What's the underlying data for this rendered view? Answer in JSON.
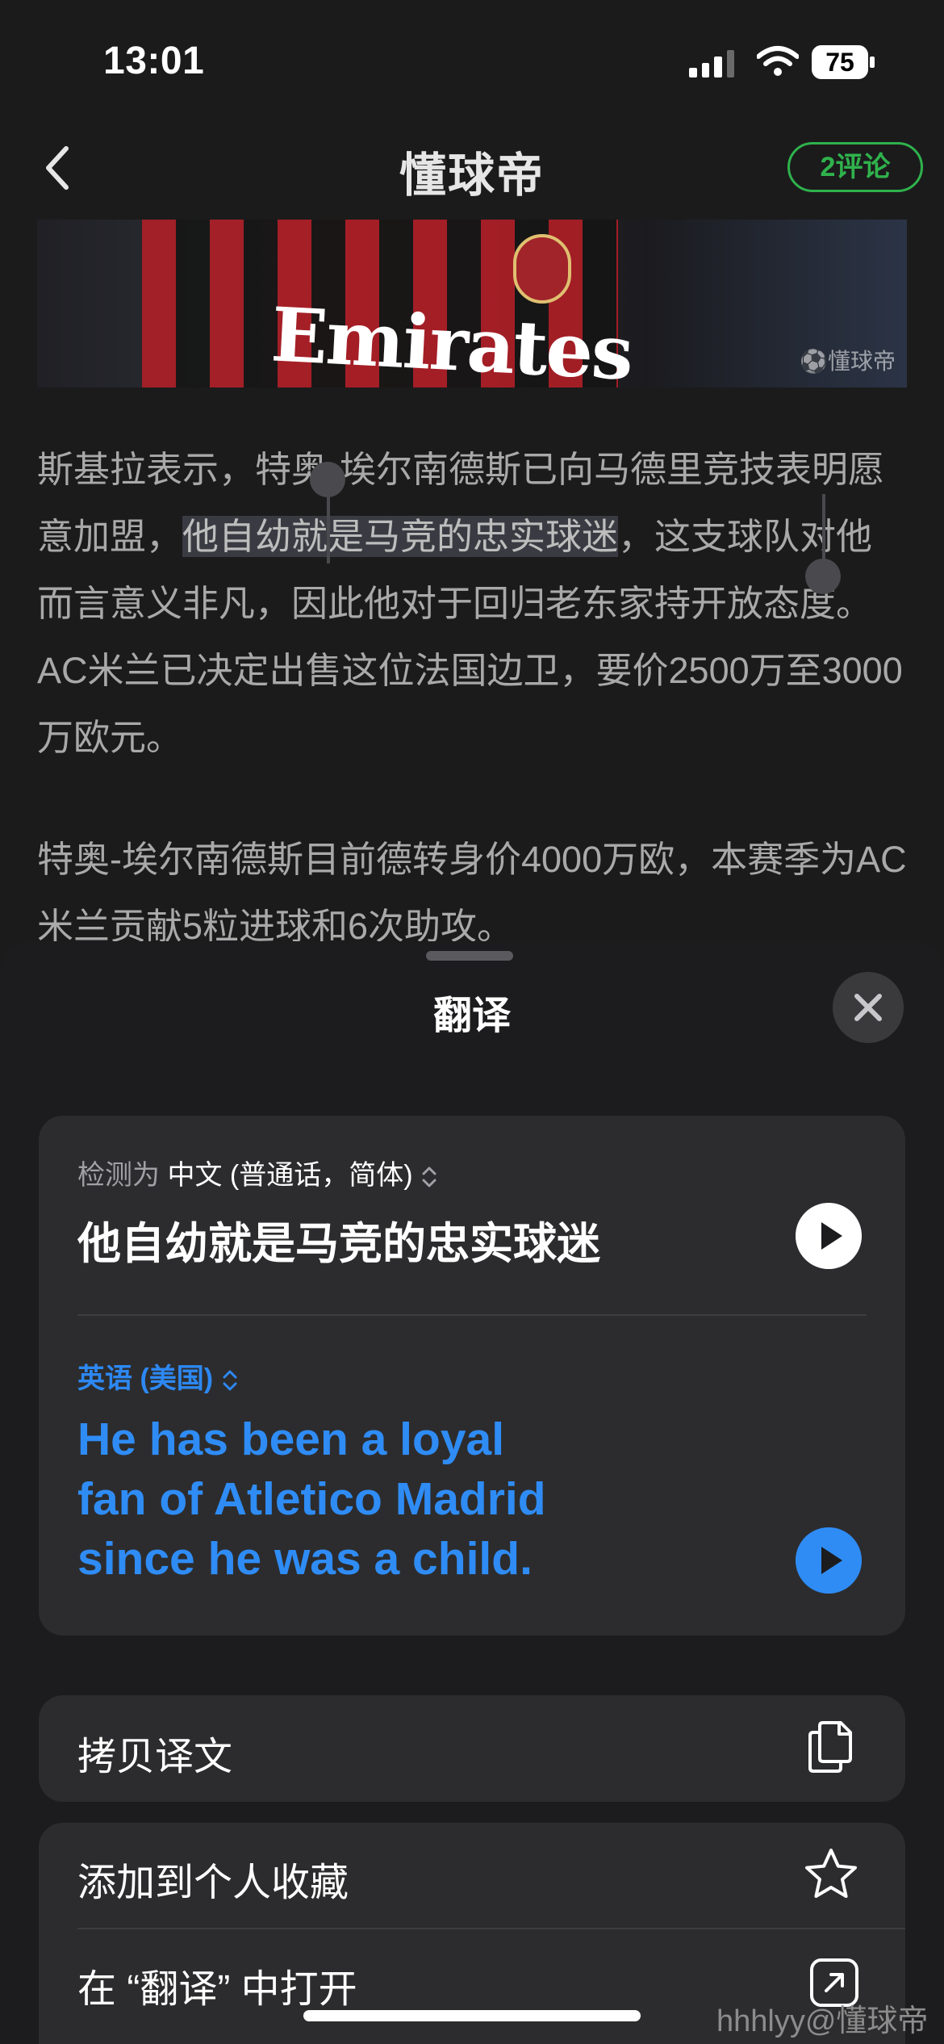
{
  "status_bar": {
    "time": "13:01",
    "battery": "75"
  },
  "nav": {
    "title": "懂球帝",
    "comments": "2评论"
  },
  "hero": {
    "sponsor": "Emirates",
    "watermark": "⚽懂球帝"
  },
  "article": {
    "para1_before": "斯基拉表示，特奥-埃尔南德斯已向马德里竞技表明愿意加盟，",
    "para1_selected": "他自幼就是马竞的忠实球迷",
    "para1_after": "，这支球队对他而言意义非凡，因此他对于回归老东家持开放态度。AC米兰已决定出售这位法国边卫，要价2500万至3000万欧元。",
    "para2": "特奥-埃尔南德斯目前德转身价4000万欧，本赛季为AC米兰贡献5粒进球和6次助攻。"
  },
  "translate_sheet": {
    "title": "翻译",
    "detect_prefix": "检测为",
    "detect_language": "中文 (普通话，简体)",
    "source_text": "他自幼就是马竞的忠实球迷",
    "target_language": "英语 (美国)",
    "target_lines": [
      "He has been a loyal",
      "fan of Atletico Madrid",
      "since he was a child."
    ],
    "actions": {
      "copy": "拷贝译文",
      "favorite": "添加到个人收藏",
      "open": "在 “翻译” 中打开"
    }
  },
  "watermark": "hhhlyy@懂球帝",
  "icons": {
    "back": "chevron-left-icon",
    "close": "close-icon",
    "copy": "copy-icon",
    "favorite": "star-icon",
    "open": "open-external-icon",
    "play": "play-icon"
  },
  "colors": {
    "accent_blue": "#2f8cf5",
    "comment_green": "#2fb24c"
  }
}
